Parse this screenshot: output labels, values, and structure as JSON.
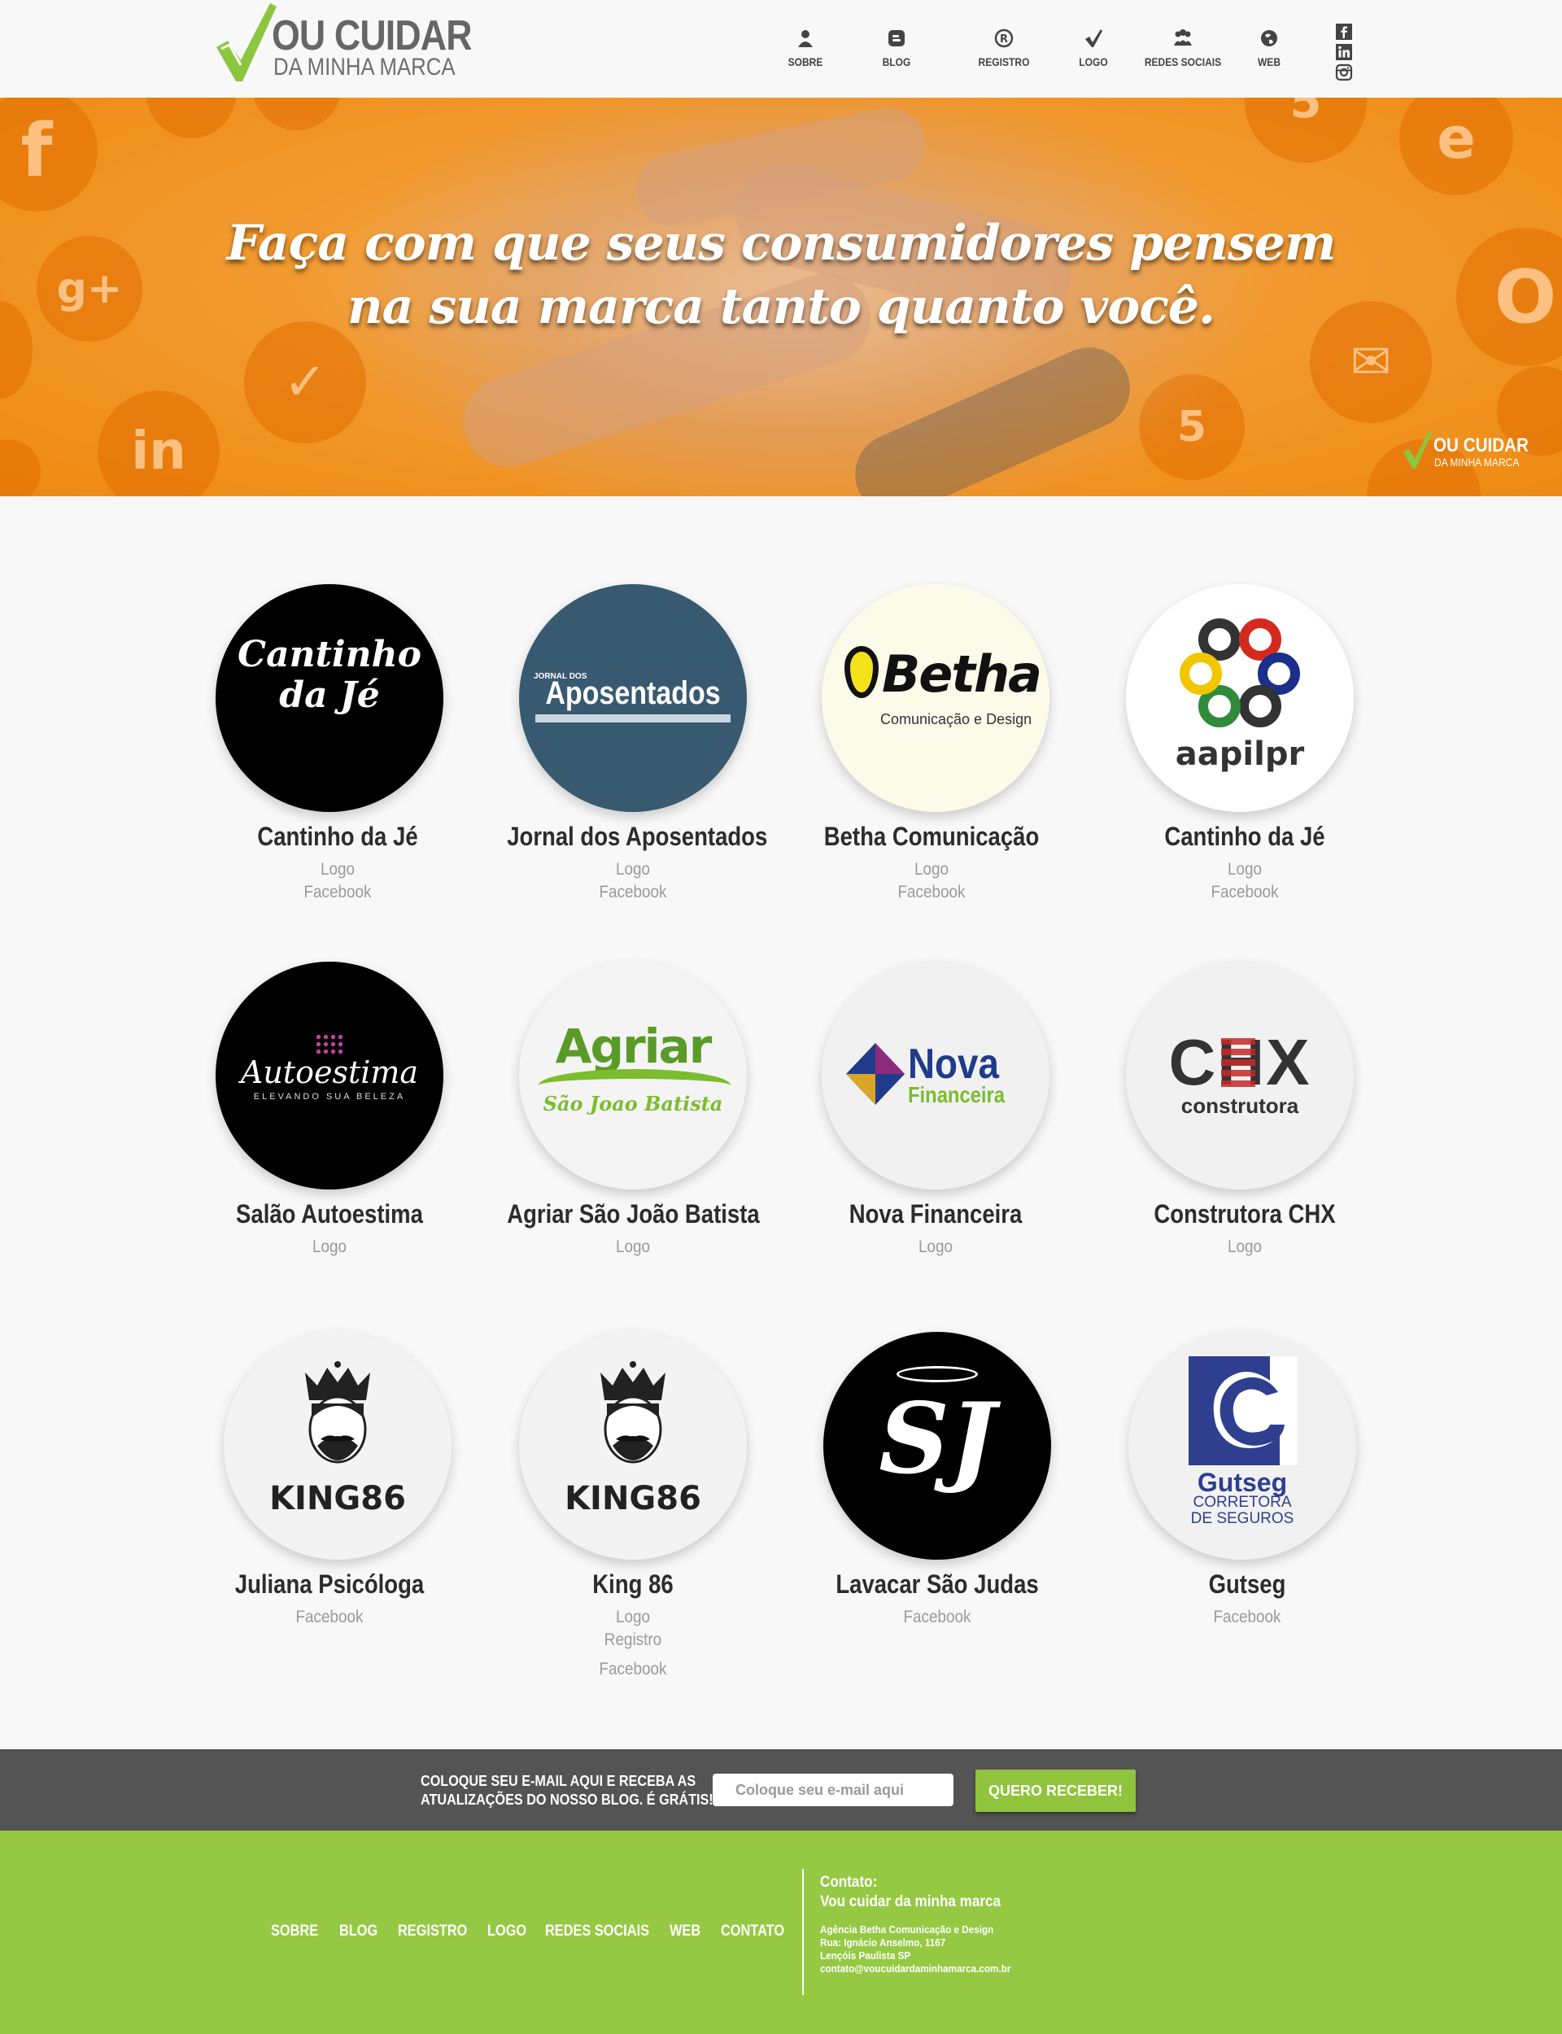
{
  "header": {
    "logo": {
      "line1": "OU CUIDAR",
      "line2": "DA MINHA MARCA",
      "check_color": "#8cc63f"
    },
    "nav": [
      {
        "label": "SOBRE",
        "icon": "user-icon"
      },
      {
        "label": "BLOG",
        "icon": "blogger-icon"
      },
      {
        "label": "REGISTRO",
        "icon": "registered-icon"
      },
      {
        "label": "LOGO",
        "icon": "check-icon"
      },
      {
        "label": "REDES SOCIAIS",
        "icon": "people-icon"
      },
      {
        "label": "WEB",
        "icon": "globe-icon"
      }
    ],
    "social": [
      "facebook-icon",
      "linkedin-icon",
      "instagram-icon"
    ]
  },
  "hero": {
    "headline_line1": "Faça com que seus consumidores pensem",
    "headline_line2": "na sua marca tanto quanto você.",
    "logo_line1": "OU CUIDAR",
    "logo_line2": "DA MINHA MARCA",
    "bg_color": "#f29a30"
  },
  "portfolio": [
    {
      "title": "Cantinho da Jé",
      "links": [
        "Logo",
        "Facebook"
      ],
      "logo_text": "Cantinho da Jé",
      "bg": "#000000"
    },
    {
      "title": "Jornal dos Aposentados",
      "links": [
        "Logo",
        "Facebook"
      ],
      "logo_small": "JORNAL DOS",
      "logo_text": "Aposentados",
      "bg": "#385a71"
    },
    {
      "title": "Betha Comunicação",
      "links": [
        "Logo",
        "Facebook"
      ],
      "logo_text": "Betha",
      "logo_sub": "Comunicação e Design",
      "bg": "#fbfbe9"
    },
    {
      "title": "Cantinho da Jé",
      "links": [
        "Logo",
        "Facebook"
      ],
      "logo_text": "aapilpr",
      "bg": "#ffffff"
    },
    {
      "title": "Salão Autoestima",
      "links": [
        "Logo"
      ],
      "logo_text": "Autoestima",
      "logo_sub": "ELEVANDO SUA BELEZA",
      "bg": "#000000"
    },
    {
      "title": "Agriar São João Batista",
      "links": [
        "Logo"
      ],
      "logo_text": "Agriar",
      "logo_sub": "São Joao Batista",
      "bg": "#f4f4f4"
    },
    {
      "title": "Nova Financeira",
      "links": [
        "Logo"
      ],
      "logo_text": "Nova",
      "logo_sub": "Financeira",
      "bg": "#f1f1f1"
    },
    {
      "title": "Construtora CHX",
      "links": [
        "Logo"
      ],
      "logo_text": "CHX",
      "logo_sub": "construtora",
      "bg": "#f1f1f1"
    },
    {
      "title": "Juliana Psicóloga",
      "links": [
        "Facebook"
      ],
      "logo_text": "KING86",
      "bg": "#f3f3f3"
    },
    {
      "title": "King 86",
      "links": [
        "Logo",
        "Registro",
        "Facebook"
      ],
      "logo_text": "KING86",
      "bg": "#f3f3f3"
    },
    {
      "title": "Lavacar São Judas",
      "links": [
        "Facebook"
      ],
      "logo_text": "SJ",
      "bg": "#000000"
    },
    {
      "title": "Gutseg",
      "links": [
        "Facebook"
      ],
      "logo_text": "Gutseg",
      "logo_sub1": "CORRETORA",
      "logo_sub2": "DE SEGUROS",
      "bg": "#f1f1f1"
    }
  ],
  "newsletter": {
    "text_line1": "COLOQUE SEU E-MAIL AQUI E RECEBA AS",
    "text_line2": "ATUALIZAÇÕES DO NOSSO BLOG. É GRÁTIS!",
    "placeholder": "Coloque seu e-mail aqui",
    "button_label": "QUERO RECEBER!"
  },
  "footer": {
    "nav": [
      "SOBRE",
      "BLOG",
      "REGISTRO",
      "LOGO",
      "REDES SOCIAIS",
      "WEB",
      "CONTATO"
    ],
    "contact_heading": "Contato:",
    "contact_name": "Vou cuidar da minha marca",
    "agency": "Agência Betha Comunicação e Design",
    "street": "Rua: Ignácio Anselmo, 1167",
    "city": "Lençóis Paulista SP",
    "email": "contato@voucuidardaminhamarca.com.br",
    "bg_color": "#95c944"
  }
}
